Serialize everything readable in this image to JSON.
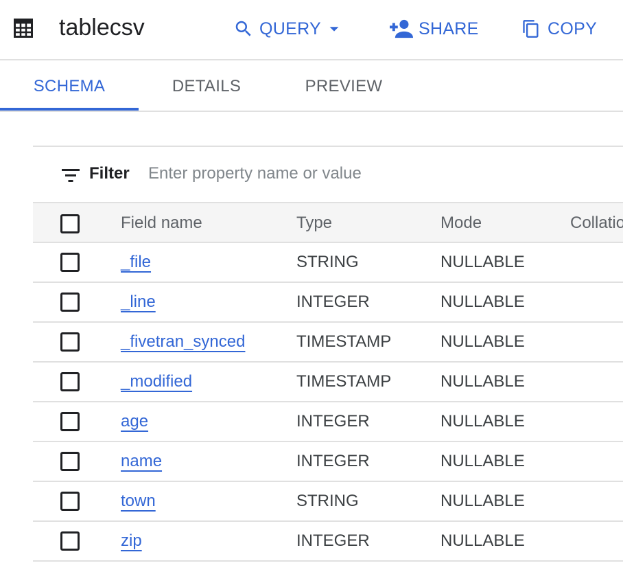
{
  "header": {
    "title": "tablecsv",
    "icon": "table-icon",
    "accent_color": "#3367d6",
    "actions": {
      "query": "QUERY",
      "share": "SHARE",
      "copy": "COPY"
    }
  },
  "tabs": [
    {
      "label": "SCHEMA",
      "active": true
    },
    {
      "label": "DETAILS",
      "active": false
    },
    {
      "label": "PREVIEW",
      "active": false
    }
  ],
  "filter": {
    "label": "Filter",
    "placeholder": "Enter property name or value",
    "value": ""
  },
  "schema": {
    "columns": [
      "Field name",
      "Type",
      "Mode",
      "Collatio"
    ],
    "rows": [
      {
        "field": "_file",
        "type": "STRING",
        "mode": "NULLABLE"
      },
      {
        "field": "_line",
        "type": "INTEGER",
        "mode": "NULLABLE"
      },
      {
        "field": "_fivetran_synced",
        "type": "TIMESTAMP",
        "mode": "NULLABLE"
      },
      {
        "field": "_modified",
        "type": "TIMESTAMP",
        "mode": "NULLABLE"
      },
      {
        "field": "age",
        "type": "INTEGER",
        "mode": "NULLABLE"
      },
      {
        "field": "name",
        "type": "INTEGER",
        "mode": "NULLABLE"
      },
      {
        "field": "town",
        "type": "STRING",
        "mode": "NULLABLE"
      },
      {
        "field": "zip",
        "type": "INTEGER",
        "mode": "NULLABLE"
      }
    ]
  }
}
